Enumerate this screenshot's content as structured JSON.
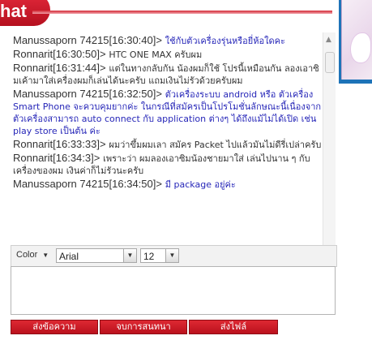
{
  "header": {
    "tab_label": "hat"
  },
  "messages": [
    {
      "sender": "Manussaporn 74215[16:30:40]>",
      "text": "ใช้กับตัวเครื่องรุ่นหรือยี่ห้อใดคะ",
      "kind": "other"
    },
    {
      "sender": "Ronnarit[16:30:50]>",
      "text": "HTC ONE MAX ครับผม",
      "kind": "own"
    },
    {
      "sender": "Ronnarit[16:31:44]>",
      "text": "แต่ในทางกลับกัน น้องผมก็ใช้ โปรนี้เหมือนกัน ลองเอาซิมเค้ามาใส่เครื่องผมก็เล่นได้นะครับ แถมเงินไม่รัวด้วยครับผม",
      "kind": "own"
    },
    {
      "sender": "Manussaporn 74215[16:32:50]>",
      "text": "ตัวเครื่องระบบ android หรือ ตัวเครื่อง Smart Phone จะควบคุมยากค่ะ ในกรณีที่สมัครเป็นโปรโมชั่นลักษณะนี้เนื่องจากตัวเครื่องสามารถ auto connect กับ application ต่างๆ ได้ถึงแม้ไม่ได้เปิด เช่น play store เป็นต้น ค่ะ",
      "kind": "other"
    },
    {
      "sender": "Ronnarit[16:33:33]>",
      "text": "ผมว่าขึ้มผมเลา สมัคร Packet ไปแล้วมันไม่ดีรี่เปล่าครับ",
      "kind": "own"
    },
    {
      "sender": "Ronnarit[16:34:3]>",
      "text": "เพราะว่า ผมลองเอาซิมน้องชายมาใส่ เล่นไปนาน ๆ กับเครื่องของผม เงินค่าก็ไม่รัวนะครับ",
      "kind": "own"
    },
    {
      "sender": "Manussaporn 74215[16:34:50]>",
      "text": "มี package อยู่ค่ะ",
      "kind": "other"
    }
  ],
  "toolbar": {
    "color_label": "Color",
    "font_value": "Arial",
    "size_value": "12"
  },
  "buttons": {
    "send": "ส่งข้อความ",
    "end": "จบการสนทนา",
    "file": "ส่งไฟล์"
  },
  "colors": {
    "accent_red": "#c8141f",
    "agent_text": "#2626b8",
    "user_text": "#333333"
  },
  "icons": [
    "scroll-up-icon",
    "color-caret-icon",
    "chevron-down-icon"
  ]
}
